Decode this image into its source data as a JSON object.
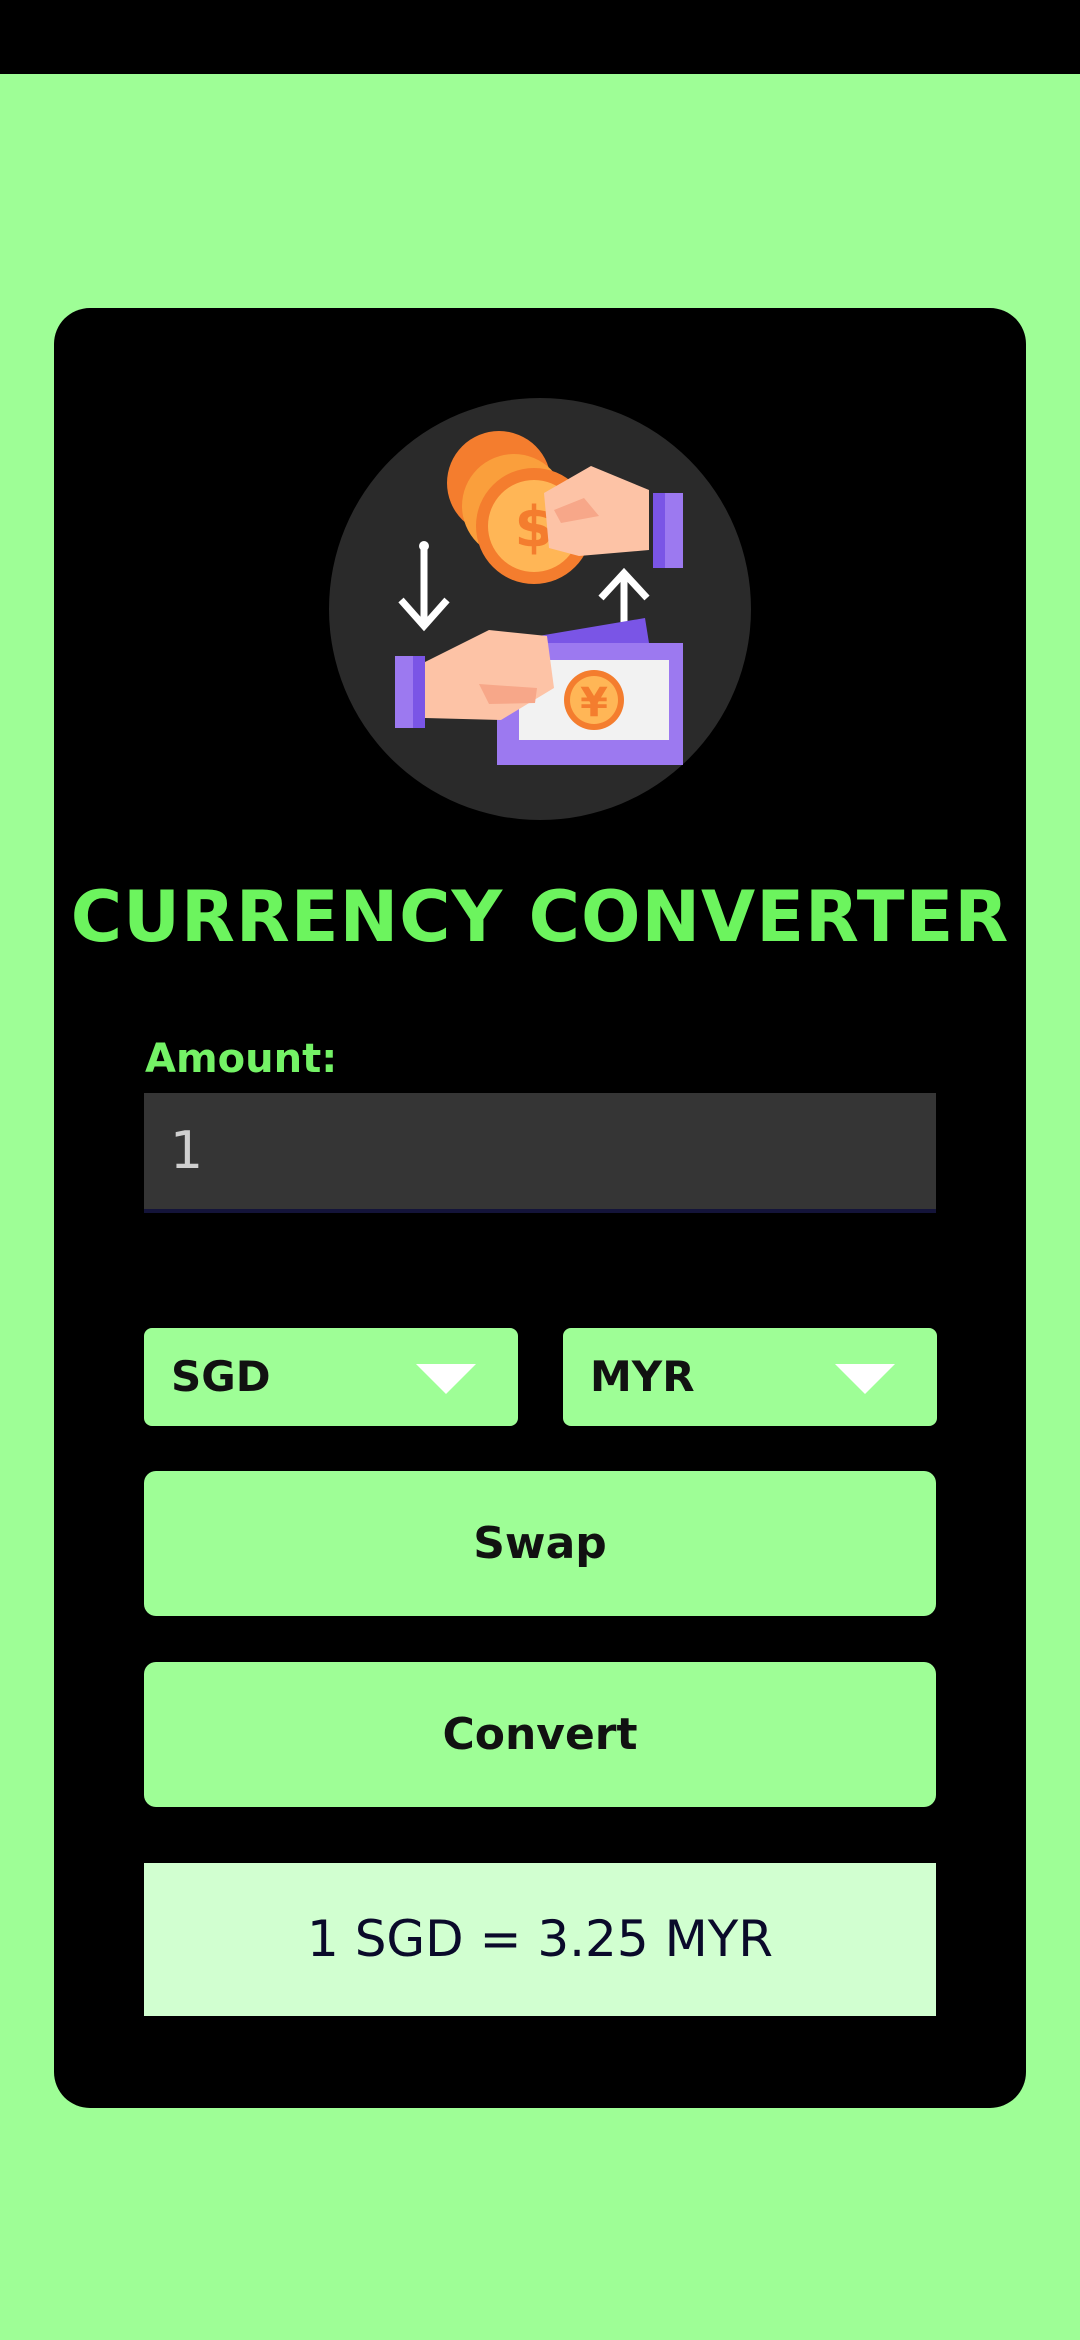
{
  "app": {
    "title": "CURRENCY CONVERTER",
    "logo_icon": "currency-exchange-icon"
  },
  "amount": {
    "label": "Amount:",
    "value": "1"
  },
  "currencies": {
    "from": "SGD",
    "to": "MYR"
  },
  "buttons": {
    "swap": "Swap",
    "convert": "Convert"
  },
  "result": {
    "text": "1 SGD = 3.25 MYR"
  },
  "colors": {
    "background": "#9efe96",
    "card": "#000000",
    "title": "#6cf45e",
    "result_bg": "#d1ffd0"
  }
}
